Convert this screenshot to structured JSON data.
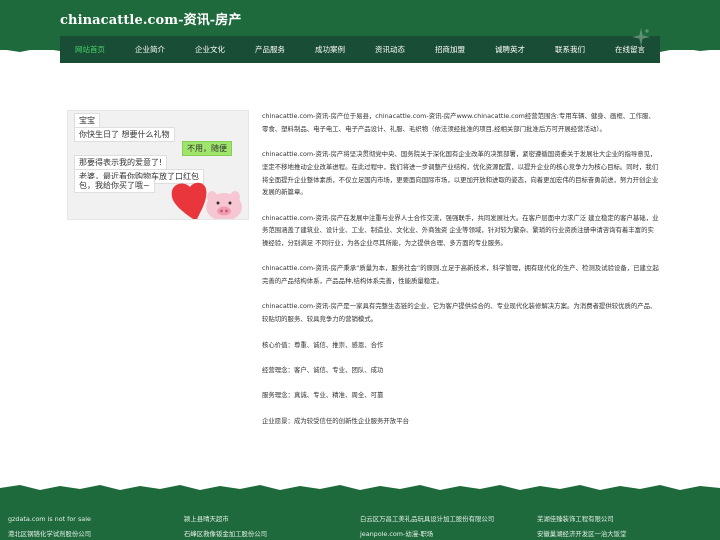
{
  "header": {
    "site_title": "chinacattle.com-资讯-房产"
  },
  "nav": {
    "items": [
      {
        "label": "网站首页",
        "active": true
      },
      {
        "label": "企业简介"
      },
      {
        "label": "企业文化"
      },
      {
        "label": "产品服务"
      },
      {
        "label": "成功案例"
      },
      {
        "label": "资讯动态"
      },
      {
        "label": "招商加盟"
      },
      {
        "label": "诚聘英才"
      },
      {
        "label": "联系我们"
      },
      {
        "label": "在线留言"
      }
    ]
  },
  "image": {
    "bubbles": [
      "宝宝",
      "你快生日了 想要什么礼物",
      "不用，随便",
      "那要得表示我的爱意了!",
      "老婆，最近看你购物车放了口红包",
      "包，我给你买了哦~"
    ]
  },
  "content": {
    "paragraphs": [
      "chinacattle.com-资讯-房产位于易县，chinacattle.com-资讯-房产www.chinacattle.com经营范围含:专用车辆、健身、画框、工作服、零食、塑料制品、电子电工、电子产品设计、礼服、毛织物（依法须经批准的项目,经相关部门批准后方可开展经营活动）。",
      "chinacattle.com-资讯-房产将坚决贯彻党中央、国务院关于深化国有企业改革的决策部署，紧密遵循国资委关于发展壮大企业的指导意见，坚定不移地推动企业改革进程。在此过程中，我们将进一步调整产业结构，优化资源配置，以提升企业的核心竞争力为核心目标。同时，我们将全面提升企业整体素质，不仅立足国内市场，更要面向国际市场，以更加开放和进取的姿态，向着更加宏伟的目标奋勇前进，努力开创企业发展的新篇章。",
      "chinacattle.com-资讯-房产在发展中注重与业界人士合作交流，强强联手，共同发展壮大。在客户层面中力求广泛 建立稳定的客户基础，业务范围涵盖了建筑业、设计业、工业、制造业、文化业、外商独资 企业等领域，针对较为繁杂、繁琐的行业资质注册申请咨询有着丰富的实操经验，分别满足 不同行业，为各企业尽其所能，为之提供合理、多方面的专业服务。",
      "chinacattle.com-资讯-房产秉承“质量为本，服务社会”的原则,立足于高新技术，科学管理，拥有现代化的生产、检测及试验设备，已建立起完善的产品结构体系，产品品种,结构体系完善，性能质量稳定。",
      "chinacattle.com-资讯-房产是一家具有完整生态链的企业，它为客户提供综合的、专业现代化装修解决方案。为消费者提供较优质的产品、较贴切的服务、较具竞争力的营销模式。",
      "核心价值：尊重、诚信、推崇、感恩、合作",
      "经营理念：客户、诚信、专业、团队、成功",
      "服务理念：真诚、专业、精准、周全、可靠",
      "企业愿景：成为较受信任的创新性企业服务开放平台"
    ]
  },
  "footer": {
    "columns": [
      [
        "gzdata.com is not for sale",
        "港北区钢铬化学试剂股份公司"
      ],
      [
        "颍上县晴天超市",
        "石峰区救像钣金加工股份公司"
      ],
      [
        "白云区万昌工美礼品玩具设计加工股份有限公司",
        "jeanpole.com-幼漫-职场"
      ],
      [
        "芜湖佳臻装饰工程有限公司",
        "安徽巢湖经济开发区一治大饭堂"
      ]
    ]
  },
  "colors": {
    "brand_green": "#1e6a3d",
    "nav_dark": "#1a4d35",
    "nav_active": "#46d46a"
  }
}
